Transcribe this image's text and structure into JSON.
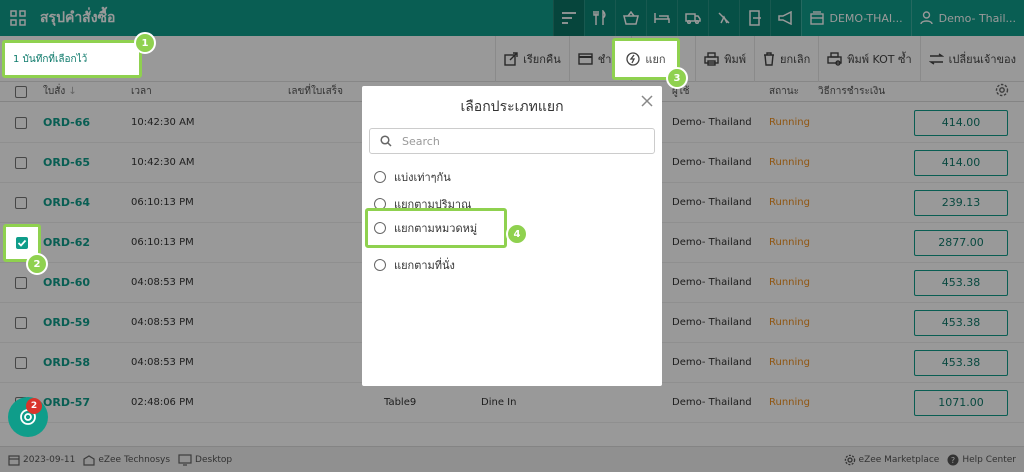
{
  "topbar": {
    "title": "สรุปคำสั่งซื้อ",
    "property": "DEMO-THAI...",
    "user": "Demo- Thail..."
  },
  "actionbar": {
    "selected_count": "1 บันทึกที่เลือกไว้",
    "actions": [
      {
        "label": "เรียกคืน"
      },
      {
        "label": "ชำระ"
      },
      {
        "label": "แยก"
      },
      {
        "label": "พิมพ์"
      },
      {
        "label": "ยกเลิก"
      },
      {
        "label": "พิมพ์ KOT ซ้ำ"
      },
      {
        "label": "เปลี่ยนเจ้าของ"
      }
    ]
  },
  "table": {
    "headers": {
      "order": "ใบสั่ง",
      "time": "เวลา",
      "receipt": "เลขที่ใบเสร็จ",
      "user": "ผู้ใช้",
      "status": "สถานะ",
      "payment": "วิธีการชำระเงิน"
    },
    "rows": [
      {
        "order": "ORD-66",
        "time": "10:42:30 AM",
        "table": "",
        "type": "",
        "user": "Demo- Thailand",
        "status": "Running",
        "amount": "414.00",
        "checked": false
      },
      {
        "order": "ORD-65",
        "time": "10:42:30 AM",
        "table": "",
        "type": "",
        "user": "Demo- Thailand",
        "status": "Running",
        "amount": "414.00",
        "checked": false
      },
      {
        "order": "ORD-64",
        "time": "06:10:13 PM",
        "table": "",
        "type": "",
        "user": "Demo- Thailand",
        "status": "Running",
        "amount": "239.13",
        "checked": false
      },
      {
        "order": "ORD-62",
        "time": "06:10:13 PM",
        "table": "",
        "type": "",
        "user": "Demo- Thailand",
        "status": "Running",
        "amount": "2877.00",
        "checked": true
      },
      {
        "order": "ORD-60",
        "time": "04:08:53 PM",
        "table": "",
        "type": "",
        "user": "Demo- Thailand",
        "status": "Running",
        "amount": "453.38",
        "checked": false
      },
      {
        "order": "ORD-59",
        "time": "04:08:53 PM",
        "table": "",
        "type": "",
        "user": "Demo- Thailand",
        "status": "Running",
        "amount": "453.38",
        "checked": false
      },
      {
        "order": "ORD-58",
        "time": "04:08:53 PM",
        "table": "",
        "type": "",
        "user": "Demo- Thailand",
        "status": "Running",
        "amount": "453.38",
        "checked": false
      },
      {
        "order": "ORD-57",
        "time": "02:48:06 PM",
        "table": "Table9",
        "type": "Dine In",
        "user": "Demo- Thailand",
        "status": "Running",
        "amount": "1071.00",
        "checked": false
      }
    ]
  },
  "modal": {
    "title": "เลือกประเภทแยก",
    "search_placeholder": "Search",
    "options": [
      {
        "label": "แบ่งเท่าๆกัน"
      },
      {
        "label": "แยกตามปริมาณ"
      },
      {
        "label": "แยกตามหมวดหมู่"
      },
      {
        "label": "แยกตามที่นั่ง"
      }
    ]
  },
  "footer": {
    "date": "2023-09-11",
    "company": "eZee Technosys",
    "device": "Desktop",
    "marketplace": "eZee Marketplace",
    "help": "Help Center"
  },
  "fab": {
    "badge": "2"
  },
  "callouts": [
    "1",
    "2",
    "3",
    "4"
  ],
  "colors": {
    "brand": "#0f9d8a",
    "status_running": "#f0901f",
    "highlight": "#8fd14f"
  }
}
